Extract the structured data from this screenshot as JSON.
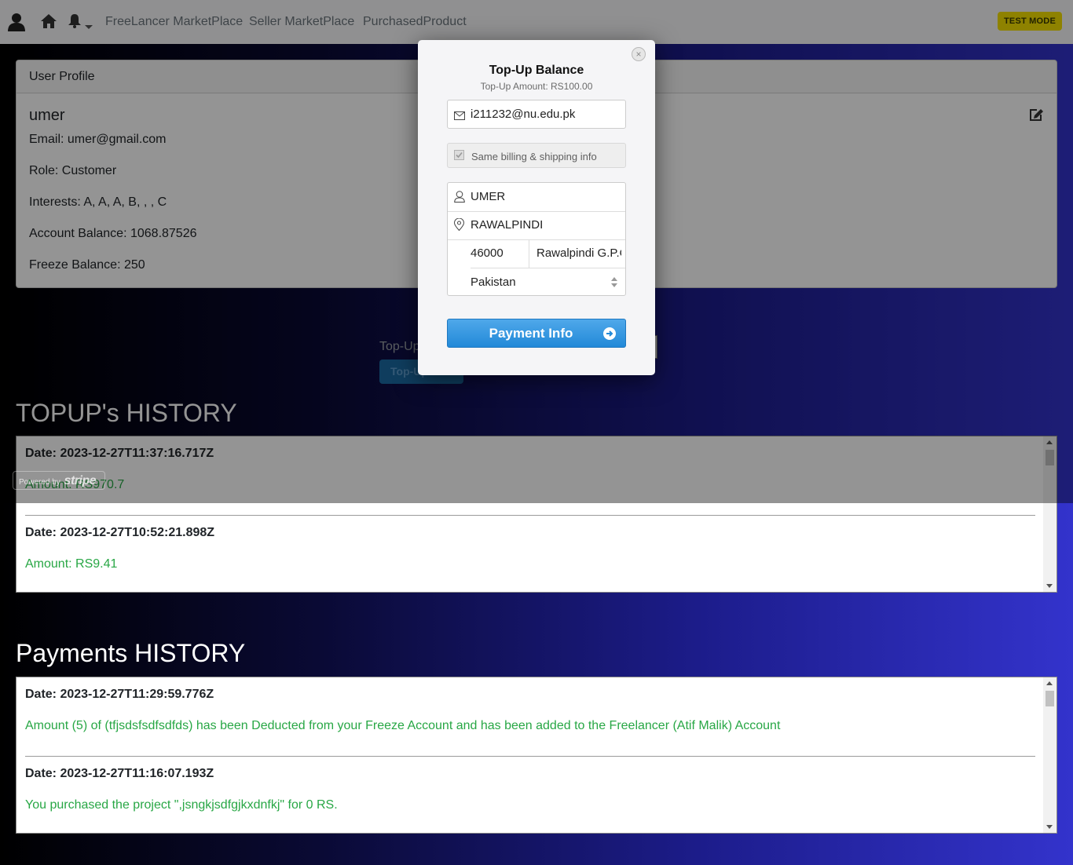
{
  "navbar": {
    "links": [
      "FreeLancer MarketPlace",
      "Seller MarketPlace",
      "PurchasedProduct"
    ],
    "test_mode": "TEST MODE"
  },
  "profile": {
    "header": "User Profile",
    "name": "umer",
    "email": "Email: umer@gmail.com",
    "role": "Role: Customer",
    "interests": "Interests: A, A, A, B, , , C",
    "balance": "Account Balance: 1068.87526",
    "freeze": "Freeze Balance: 250"
  },
  "topup_form": {
    "label": "Top-Up",
    "button": "Top-Up"
  },
  "topups": {
    "title": "TOPUP's HISTORY",
    "entries": [
      {
        "date": "Date: 2023-12-27T11:37:16.717Z",
        "amount": "Amount: RS970.7"
      },
      {
        "date": "Date: 2023-12-27T10:52:21.898Z",
        "amount": "Amount: RS9.41"
      }
    ]
  },
  "payments": {
    "title": "Payments HISTORY",
    "entries": [
      {
        "date": "Date: 2023-12-27T11:29:59.776Z",
        "text": "Amount (5) of (tfjsdsfsdfsdfds) has been Deducted from your Freeze Account and has been added to the Freelancer (Atif Malik) Account"
      },
      {
        "date": "Date: 2023-12-27T11:16:07.193Z",
        "text": "You purchased the project \",jsngkjsdfgjkxdnfkj\" for 0 RS."
      }
    ]
  },
  "stripe": {
    "powered_by": "Powered by",
    "brand": "stripe"
  },
  "modal": {
    "close": "×",
    "title": "Top-Up Balance",
    "subtitle": "Top-Up Amount: RS100.00",
    "email": "i211232@nu.edu.pk",
    "same_billing": "Same billing & shipping info",
    "name": "UMER",
    "address": "RAWALPINDI",
    "zip": "46000",
    "city": "Rawalpindi G.P.O",
    "country": "Pakistan",
    "pay_button": "Payment Info"
  }
}
